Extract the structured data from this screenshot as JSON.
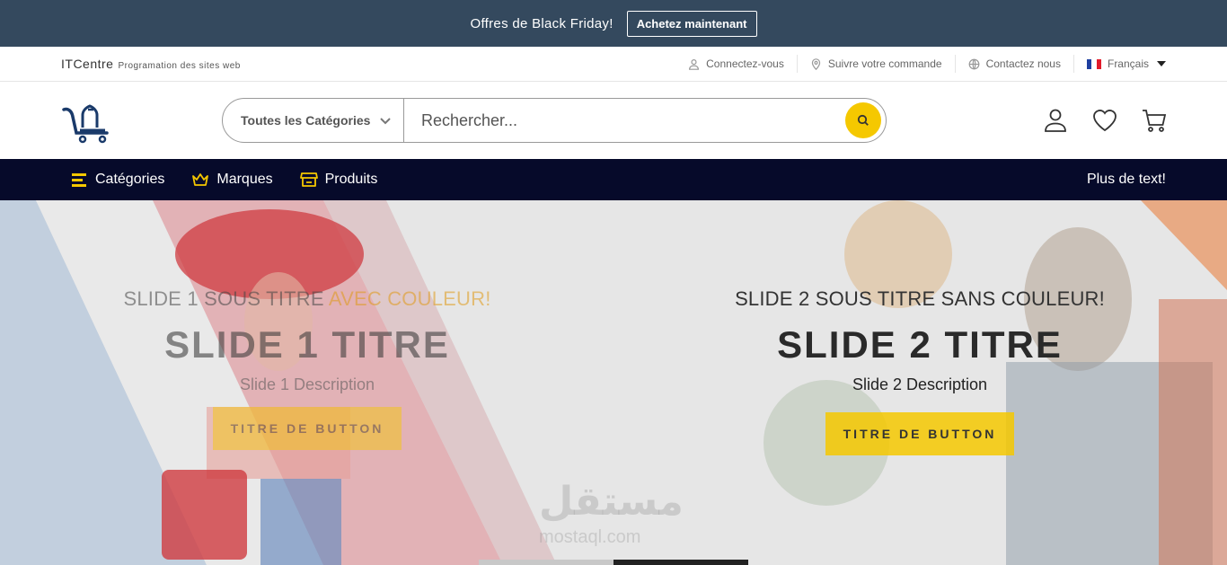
{
  "promo": {
    "text": "Offres de Black Friday!",
    "button": "Achetez maintenant"
  },
  "topbar": {
    "brand_name": "ITCentre",
    "brand_tagline": "Programation des sites web",
    "links": [
      {
        "label": "Connectez-vous",
        "icon": "user-icon"
      },
      {
        "label": "Suivre votre commande",
        "icon": "location-pin-icon"
      },
      {
        "label": "Contactez nous",
        "icon": "globe-icon"
      }
    ],
    "language": "Français"
  },
  "search": {
    "category": "Toutes les Catégories",
    "placeholder": "Rechercher..."
  },
  "nav": {
    "items": [
      {
        "label": "Catégories",
        "icon": "list-icon"
      },
      {
        "label": "Marques",
        "icon": "crown-icon"
      },
      {
        "label": "Produits",
        "icon": "store-icon"
      }
    ],
    "right": "Plus de text!"
  },
  "slides": [
    {
      "subtitle_a": "SLIDE 1 SOUS TITRE ",
      "subtitle_accent": "AVEC COULEUR!",
      "title": "SLIDE 1 TITRE",
      "description": "Slide 1 Description",
      "button": "TITRE DE BUTTON"
    },
    {
      "subtitle": "SLIDE 2 SOUS TITRE SANS COULEUR!",
      "title": "SLIDE 2 TITRE",
      "description": "Slide 2 Description",
      "button": "TITRE DE BUTTON"
    }
  ],
  "watermark": {
    "text": "مستقل",
    "url": "mostaql.com"
  },
  "colors": {
    "promo_bg": "#34495e",
    "nav_bg": "#060a2a",
    "accent": "#f5c800"
  }
}
